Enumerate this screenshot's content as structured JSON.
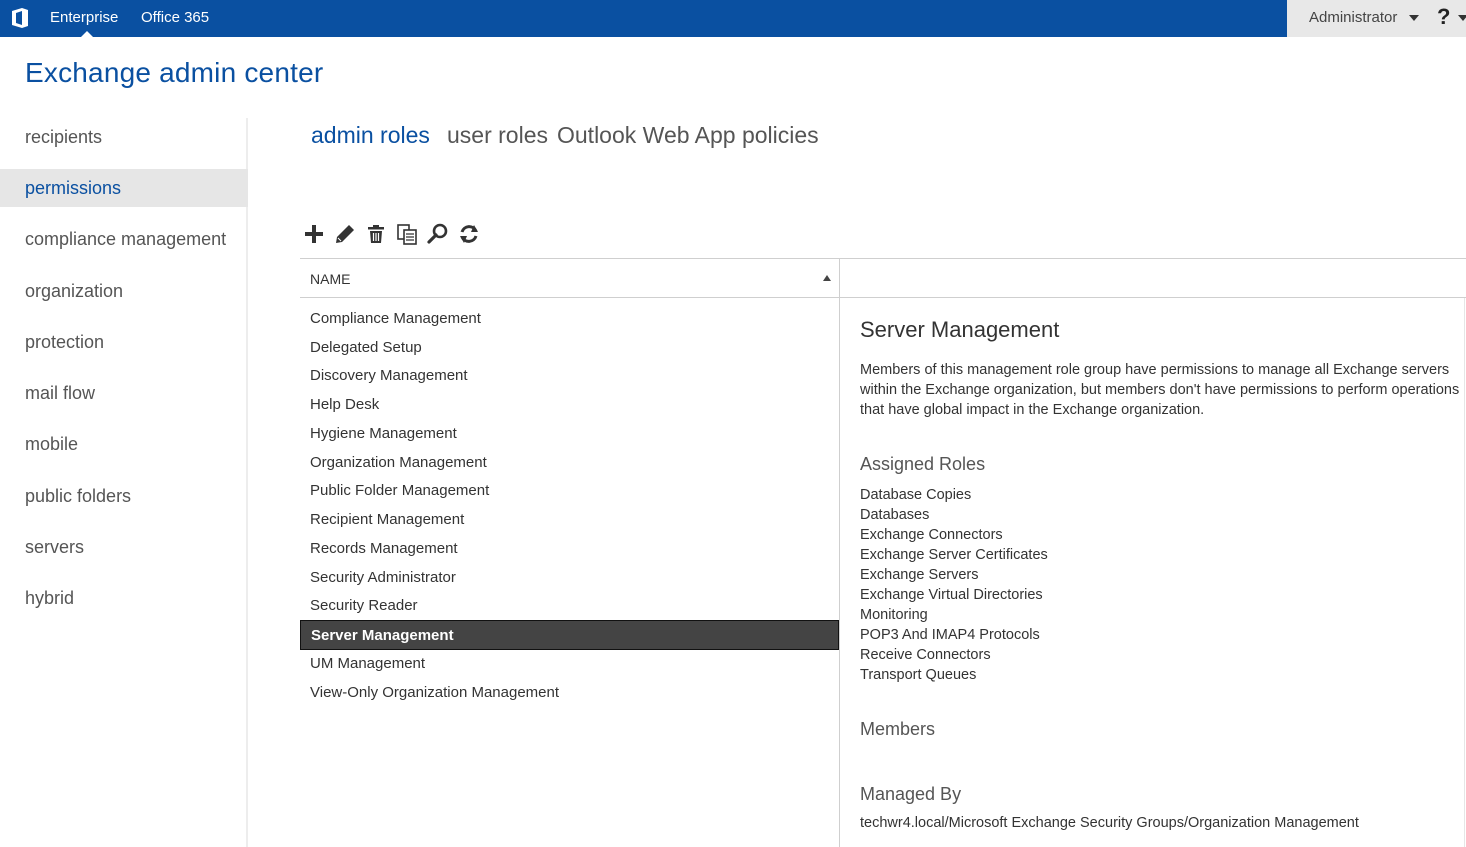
{
  "topbar": {
    "nav": [
      "Enterprise",
      "Office 365"
    ],
    "user": "Administrator",
    "help": "?"
  },
  "app_title": "Exchange admin center",
  "leftnav": {
    "items": [
      "recipients",
      "permissions",
      "compliance management",
      "organization",
      "protection",
      "mail flow",
      "mobile",
      "public folders",
      "servers",
      "hybrid"
    ],
    "selected": "permissions"
  },
  "tabs": [
    {
      "label": "admin roles",
      "active": true
    },
    {
      "label": "user roles",
      "active": false
    },
    {
      "label": "Outlook Web App policies",
      "active": false
    }
  ],
  "toolbar": {
    "icons": [
      "add-icon",
      "edit-icon",
      "delete-icon",
      "copy-icon",
      "search-icon",
      "refresh-icon"
    ]
  },
  "list": {
    "column_header": "NAME",
    "sort": "ascending",
    "rows": [
      "Compliance Management",
      "Delegated Setup",
      "Discovery Management",
      "Help Desk",
      "Hygiene Management",
      "Organization Management",
      "Public Folder Management",
      "Recipient Management",
      "Records Management",
      "Security Administrator",
      "Security Reader",
      "Server Management",
      "UM Management",
      "View-Only Organization Management"
    ],
    "selected": "Server Management"
  },
  "details": {
    "title": "Server Management",
    "description": "Members of this management role group have permissions to manage all Exchange servers within the Exchange organization, but members don't have permissions to perform operations that have global impact in the Exchange organization.",
    "assigned_roles_heading": "Assigned Roles",
    "assigned_roles": [
      "Database Copies",
      "Databases",
      "Exchange Connectors",
      "Exchange Server Certificates",
      "Exchange Servers",
      "Exchange Virtual Directories",
      "Monitoring",
      "POP3 And IMAP4 Protocols",
      "Receive Connectors",
      "Transport Queues"
    ],
    "members_heading": "Members",
    "managed_by_heading": "Managed By",
    "managed_by": "techwr4.local/Microsoft Exchange Security Groups/Organization Management"
  },
  "colors": {
    "brand": "#0a50a1",
    "selected_row": "#444444",
    "nav_selected_bg": "#e6e6e6"
  }
}
